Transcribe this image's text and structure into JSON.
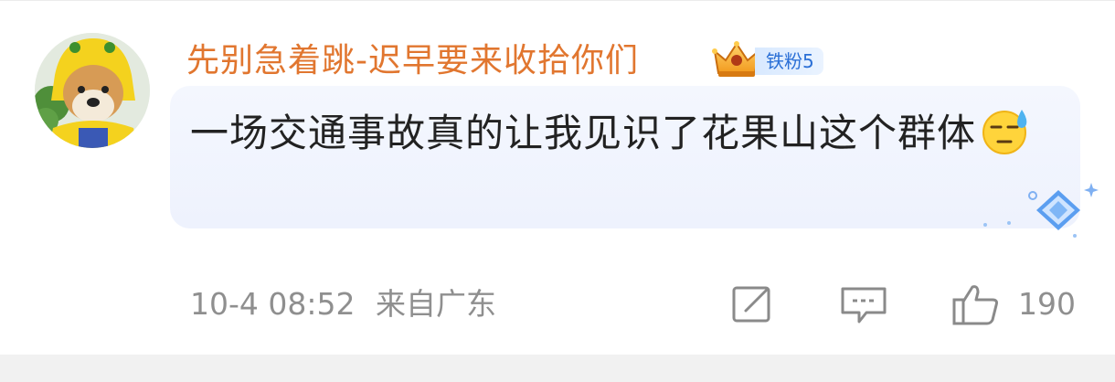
{
  "comment": {
    "username": "先别急着跳-迟早要来收拾你们",
    "fan_badge": "铁粉5",
    "text": "一场交通事故真的让我见识了花果山这个群体",
    "emoji": "sweat-smile-emoji",
    "timestamp": "10-4 08:52",
    "location": "来自广东",
    "like_count": "190"
  },
  "colors": {
    "username": "#e1762f",
    "badge_text": "#2a6fd6",
    "meta_text": "#8f8f8f",
    "bubble": "#f0f4fe"
  },
  "icons": {
    "avatar": "shiba-dog-in-yellow-hood",
    "crown": "crown-icon",
    "edit": "edit-icon",
    "reply": "reply-icon",
    "like": "thumbs-up-icon"
  }
}
